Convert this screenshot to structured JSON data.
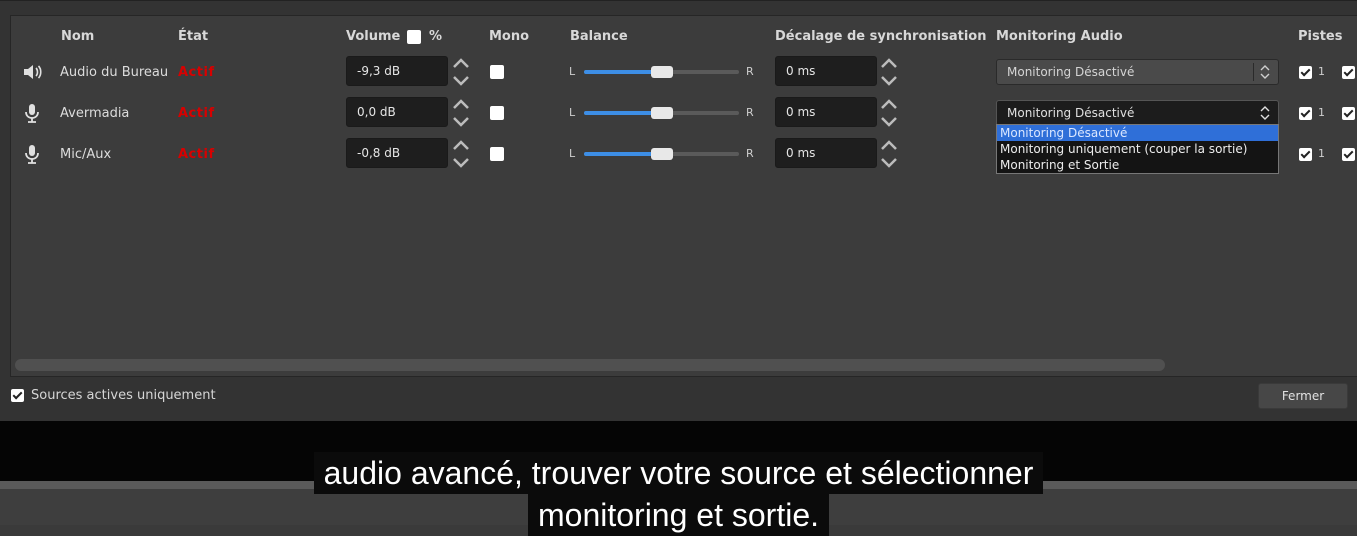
{
  "headers": {
    "name": "Nom",
    "state": "État",
    "volume": "Volume",
    "percent": "%",
    "mono": "Mono",
    "balance": "Balance",
    "sync_offset": "Décalage de synchronisation",
    "monitoring": "Monitoring Audio",
    "tracks": "Pistes"
  },
  "rows": [
    {
      "icon": "speaker-icon",
      "name": "Audio du Bureau",
      "state": "Actif",
      "volume": "-9,3 dB",
      "mono": false,
      "balance_left": "L",
      "balance_right": "R",
      "balance_value": 0.5,
      "sync": "0 ms",
      "monitoring": "Monitoring Désactivé",
      "track1_checked": true,
      "track1_label": "1"
    },
    {
      "icon": "microphone-icon",
      "name": "Avermadia",
      "state": "Actif",
      "volume": "0,0 dB",
      "mono": false,
      "balance_left": "L",
      "balance_right": "R",
      "balance_value": 0.5,
      "sync": "0 ms",
      "monitoring": "Monitoring Désactivé",
      "track1_checked": true,
      "track1_label": "1"
    },
    {
      "icon": "microphone-icon",
      "name": "Mic/Aux",
      "state": "Actif",
      "volume": "-0,8 dB",
      "mono": false,
      "balance_left": "L",
      "balance_right": "R",
      "balance_value": 0.5,
      "sync": "0 ms",
      "monitoring": "Monitoring Désactivé",
      "track1_checked": true,
      "track1_label": "1"
    }
  ],
  "monitoring_dropdown": {
    "options": [
      "Monitoring Désactivé",
      "Monitoring uniquement (couper la sortie)",
      "Monitoring et Sortie"
    ],
    "selected_index": 0
  },
  "footer": {
    "active_only_label": "Sources actives uniquement",
    "active_only_checked": true,
    "close_label": "Fermer"
  },
  "subtitles": {
    "line1": "audio avancé, trouver votre source et sélectionner",
    "line2": "monitoring et sortie."
  },
  "colors": {
    "state_active": "#d80000",
    "slider_fill": "#3d8ee6",
    "dropdown_selected": "#2f6fd8"
  }
}
